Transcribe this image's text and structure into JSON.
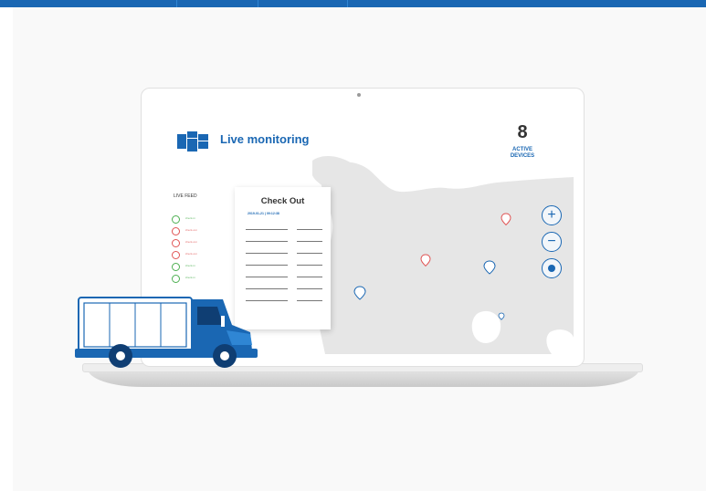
{
  "header": {
    "title": "Live monitoring",
    "active_count": "8",
    "active_label": "ACTIVE",
    "devices_label": "DEVICES"
  },
  "live_feed": {
    "title": "LIVE FEED",
    "items": [
      {
        "status": "check-in",
        "color": "#4caf50"
      },
      {
        "status": "check-out",
        "color": "#e05555"
      },
      {
        "status": "check-out",
        "color": "#e05555"
      },
      {
        "status": "check-out",
        "color": "#e05555"
      },
      {
        "status": "check-in",
        "color": "#4caf50"
      },
      {
        "status": "check-in",
        "color": "#4caf50"
      }
    ]
  },
  "checkout_card": {
    "title": "Check Out",
    "timestamp": "2019-01-21 | 09:12:38"
  },
  "map": {
    "controls": {
      "zoom_in": "+",
      "zoom_out": "−"
    },
    "pins": [
      {
        "color": "#e05555"
      },
      {
        "color": "#e05555"
      },
      {
        "color": "#1a67b3"
      },
      {
        "color": "#1a67b3"
      },
      {
        "color": "#1a67b3"
      }
    ]
  },
  "colors": {
    "brand": "#1a67b3",
    "map_land": "#e6e6e6",
    "check_in": "#4caf50",
    "check_out": "#e05555"
  },
  "icons": [
    "dashboard-logo-icon",
    "zoom-in-icon",
    "zoom-out-icon",
    "locate-icon",
    "map-pin-icon",
    "truck-icon"
  ]
}
